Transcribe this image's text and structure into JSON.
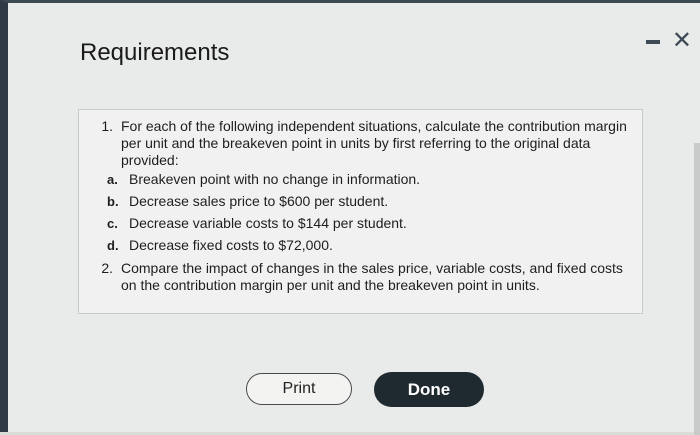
{
  "dialog": {
    "title": "Requirements",
    "minimize_icon": "minimize-icon",
    "close_icon": "close-icon"
  },
  "requirements": [
    {
      "number": "1.",
      "text": "For each of the following independent situations, calculate the contribution margin per unit and the breakeven point in units by first referring to the original data provided:",
      "subitems": [
        {
          "letter": "a.",
          "text": "Breakeven point with no change in information."
        },
        {
          "letter": "b.",
          "text": "Decrease sales price to $600 per student."
        },
        {
          "letter": "c.",
          "text": "Decrease variable costs to $144 per student."
        },
        {
          "letter": "d.",
          "text": "Decrease fixed costs to $72,000."
        }
      ]
    },
    {
      "number": "2.",
      "text": "Compare the impact of changes in the sales price, variable costs, and fixed costs on the contribution margin per unit and the breakeven point in units."
    }
  ],
  "buttons": {
    "print_label": "Print",
    "done_label": "Done"
  },
  "colors": {
    "done_background": "#1f2a30",
    "dialog_background": "#e9ebea"
  }
}
